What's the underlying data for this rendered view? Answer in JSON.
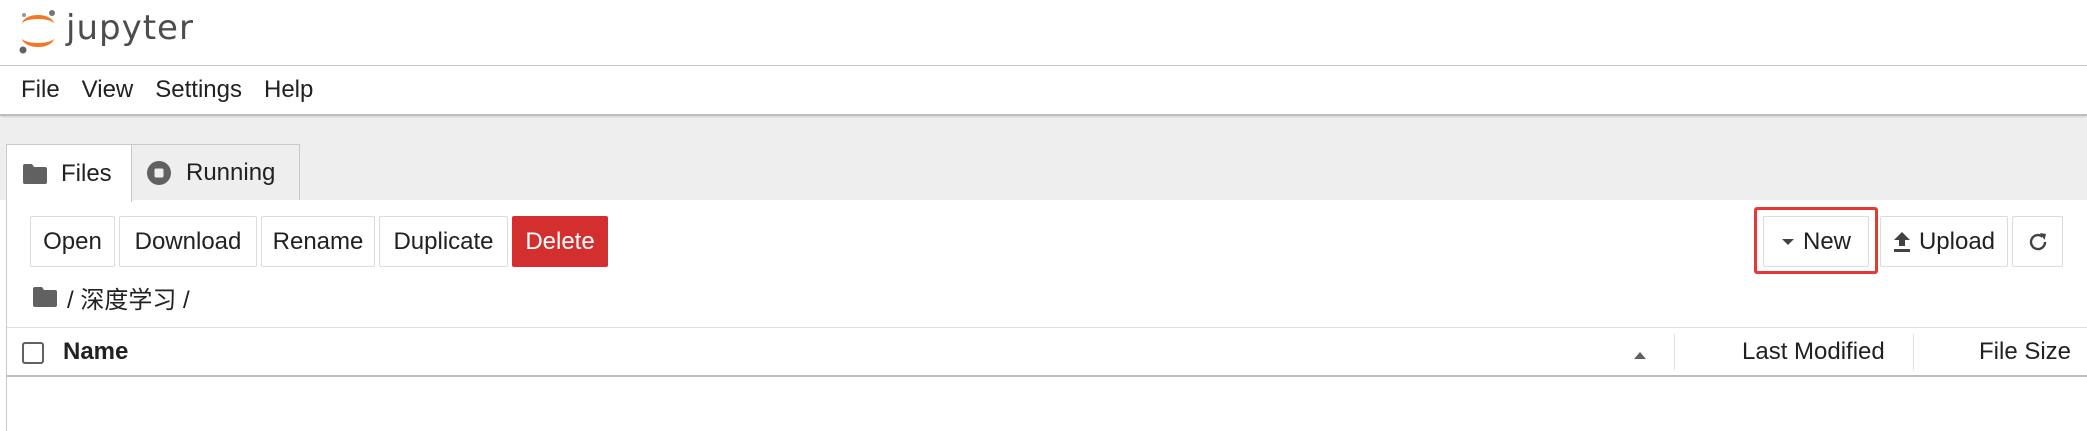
{
  "app": {
    "logo_text": "jupyter"
  },
  "menubar": {
    "items": [
      "File",
      "View",
      "Settings",
      "Help"
    ]
  },
  "tabs": [
    {
      "label": "Files",
      "icon": "folder-icon",
      "active": true
    },
    {
      "label": "Running",
      "icon": "stop-circle-icon",
      "active": false
    }
  ],
  "toolbar": {
    "open_label": "Open",
    "download_label": "Download",
    "rename_label": "Rename",
    "duplicate_label": "Duplicate",
    "delete_label": "Delete",
    "new_label": "New",
    "upload_label": "Upload",
    "refresh_icon": "refresh-icon"
  },
  "breadcrumb": {
    "path_text": "/ 深度学习 /"
  },
  "listing": {
    "columns": {
      "name": "Name",
      "last_modified": "Last Modified",
      "file_size": "File Size"
    },
    "sort": "ascending"
  },
  "colors": {
    "delete": "#d32f2f",
    "highlight": "#e53935",
    "jupyter_orange": "#f37726",
    "tab_bg": "#eeeeee"
  }
}
